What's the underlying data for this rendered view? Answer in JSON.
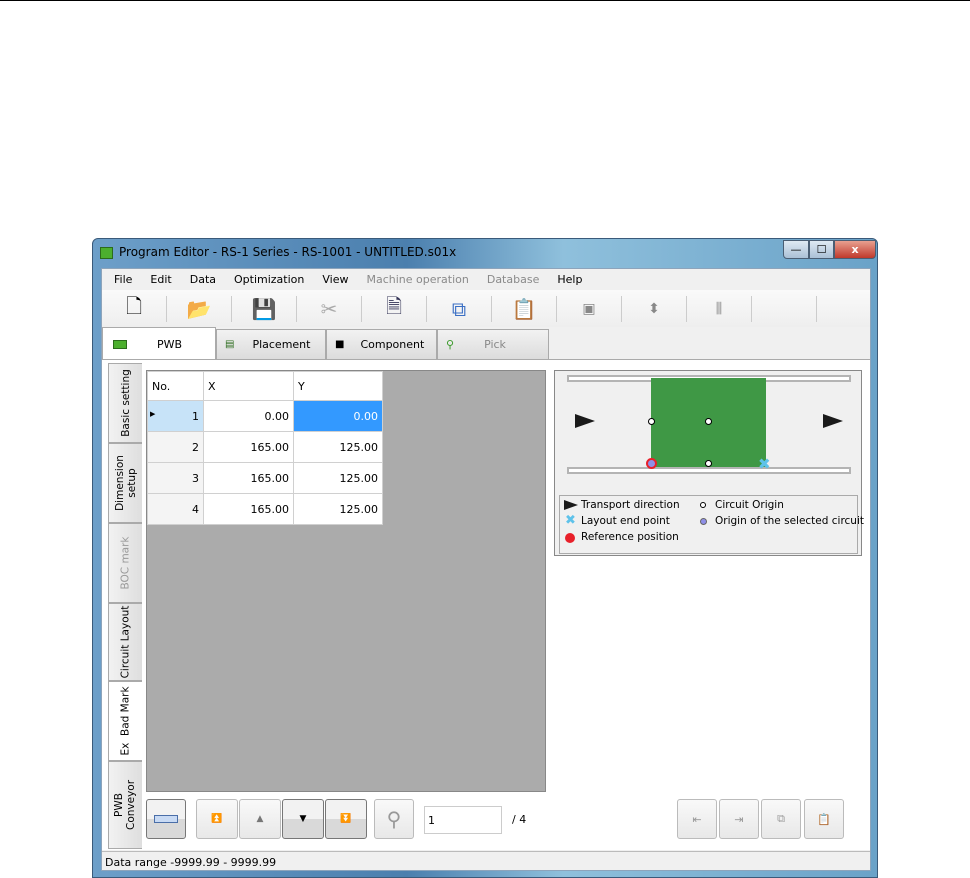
{
  "window": {
    "title": "Program Editor - RS-1 Series - RS-1001 - UNTITLED.s01x",
    "controls": {
      "minimize": "—",
      "maximize": "☐",
      "close": "x"
    }
  },
  "menu": [
    {
      "label": "File",
      "enabled": true
    },
    {
      "label": "Edit",
      "enabled": true
    },
    {
      "label": "Data",
      "enabled": true
    },
    {
      "label": "Optimization",
      "enabled": true
    },
    {
      "label": "View",
      "enabled": true
    },
    {
      "label": "Machine operation",
      "enabled": false
    },
    {
      "label": "Database",
      "enabled": false
    },
    {
      "label": "Help",
      "enabled": true
    }
  ],
  "toolbar": [
    "new-document",
    "open-folder",
    "save",
    "cut",
    "delete-document",
    "copy",
    "paste",
    "transport",
    "width-adjust",
    "nozzles"
  ],
  "tabs": [
    {
      "label": "PWB",
      "active": true
    },
    {
      "label": "Placement"
    },
    {
      "label": "Component"
    },
    {
      "label": "Pick",
      "disabled": true
    }
  ],
  "side_tabs": [
    {
      "label": "Basic setting"
    },
    {
      "label": "Dimension setup"
    },
    {
      "label": "BOC mark",
      "disabled": true
    },
    {
      "label": "Circuit Layout"
    },
    {
      "label": "Ex  Bad Mark",
      "active": true
    },
    {
      "label": "PWB Conveyor"
    }
  ],
  "table": {
    "columns": [
      "No.",
      "X",
      "Y"
    ],
    "rows": [
      [
        "1",
        "0.00",
        "0.00"
      ],
      [
        "2",
        "165.00",
        "125.00"
      ],
      [
        "3",
        "165.00",
        "125.00"
      ],
      [
        "4",
        "165.00",
        "125.00"
      ]
    ]
  },
  "legend": {
    "transport": "Transport direction",
    "end": "Layout end point",
    "reference": "Reference position",
    "origin": "Circuit Origin",
    "selected": "Origin of the selected circuit"
  },
  "nav": {
    "page_value": "1",
    "page_total": "/ 4"
  },
  "status": {
    "text": "Data range  -9999.99 - 9999.99"
  },
  "colors": {
    "board": "#3f9845",
    "selection": "#3399ff"
  }
}
